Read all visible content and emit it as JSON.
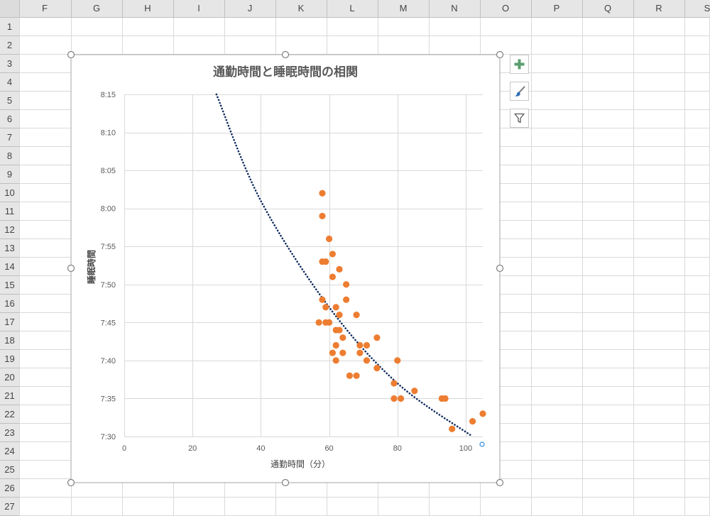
{
  "sheet": {
    "columns": [
      "F",
      "G",
      "H",
      "I",
      "J",
      "K",
      "L",
      "M",
      "N",
      "O",
      "P",
      "Q",
      "R",
      "S"
    ],
    "rows": [
      "1",
      "2",
      "3",
      "4",
      "5",
      "6",
      "7",
      "8",
      "9",
      "10",
      "11",
      "12",
      "13",
      "14",
      "15",
      "16",
      "17",
      "18",
      "19",
      "20",
      "21",
      "22",
      "23",
      "24",
      "25",
      "26",
      "27"
    ]
  },
  "chart_buttons": [
    {
      "name": "chart-elements-button",
      "icon": "plus-icon",
      "color": "#5a9e6f"
    },
    {
      "name": "chart-styles-button",
      "icon": "brush-icon",
      "color": "#2f6eb5"
    },
    {
      "name": "chart-filters-button",
      "icon": "filter-icon",
      "color": "#595959"
    }
  ],
  "chart_data": {
    "type": "scatter",
    "title": "通勤時間と睡眠時間の相関",
    "xlabel": "通勤時間（分）",
    "ylabel": "睡眠時間",
    "xlim": [
      0,
      105
    ],
    "x_ticks": [
      "0",
      "20",
      "40",
      "60",
      "80",
      "100"
    ],
    "x_tick_values": [
      0,
      20,
      40,
      60,
      80,
      100
    ],
    "ylim": [
      "7:30",
      "8:15"
    ],
    "y_ticks": [
      "8:15",
      "8:10",
      "8:05",
      "8:00",
      "7:55",
      "7:50",
      "7:45",
      "7:40",
      "7:35",
      "7:30"
    ],
    "y_tick_values": [
      "8:15",
      "8:10",
      "8:05",
      "8:00",
      "7:55",
      "7:50",
      "7:45",
      "7:40",
      "7:35",
      "7:30"
    ],
    "grid": true,
    "marker_color": "#ed7d31",
    "trendline": {
      "type": "exponential",
      "style": "dotted",
      "color": "#0e2a5c",
      "points": [
        [
          27,
          "8:15"
        ],
        [
          40,
          "8:01"
        ],
        [
          60,
          "7:47"
        ],
        [
          80,
          "7:37"
        ],
        [
          102,
          "7:30"
        ]
      ]
    },
    "points": [
      [
        58,
        "8:02"
      ],
      [
        58,
        "7:59"
      ],
      [
        60,
        "7:56"
      ],
      [
        61,
        "7:54"
      ],
      [
        58,
        "7:53"
      ],
      [
        59,
        "7:53"
      ],
      [
        63,
        "7:52"
      ],
      [
        61,
        "7:51"
      ],
      [
        65,
        "7:50"
      ],
      [
        58,
        "7:48"
      ],
      [
        65,
        "7:48"
      ],
      [
        59,
        "7:47"
      ],
      [
        62,
        "7:47"
      ],
      [
        63,
        "7:46"
      ],
      [
        68,
        "7:46"
      ],
      [
        57,
        "7:45"
      ],
      [
        59,
        "7:45"
      ],
      [
        60,
        "7:45"
      ],
      [
        62,
        "7:44"
      ],
      [
        63,
        "7:44"
      ],
      [
        64,
        "7:43"
      ],
      [
        74,
        "7:43"
      ],
      [
        62,
        "7:42"
      ],
      [
        69,
        "7:42"
      ],
      [
        71,
        "7:42"
      ],
      [
        61,
        "7:41"
      ],
      [
        64,
        "7:41"
      ],
      [
        69,
        "7:41"
      ],
      [
        62,
        "7:40"
      ],
      [
        71,
        "7:40"
      ],
      [
        80,
        "7:40"
      ],
      [
        74,
        "7:39"
      ],
      [
        66,
        "7:38"
      ],
      [
        68,
        "7:38"
      ],
      [
        79,
        "7:37"
      ],
      [
        85,
        "7:36"
      ],
      [
        79,
        "7:35"
      ],
      [
        81,
        "7:35"
      ],
      [
        93,
        "7:35"
      ],
      [
        94,
        "7:35"
      ],
      [
        105,
        "7:33"
      ],
      [
        102,
        "7:32"
      ],
      [
        96,
        "7:31"
      ]
    ]
  }
}
